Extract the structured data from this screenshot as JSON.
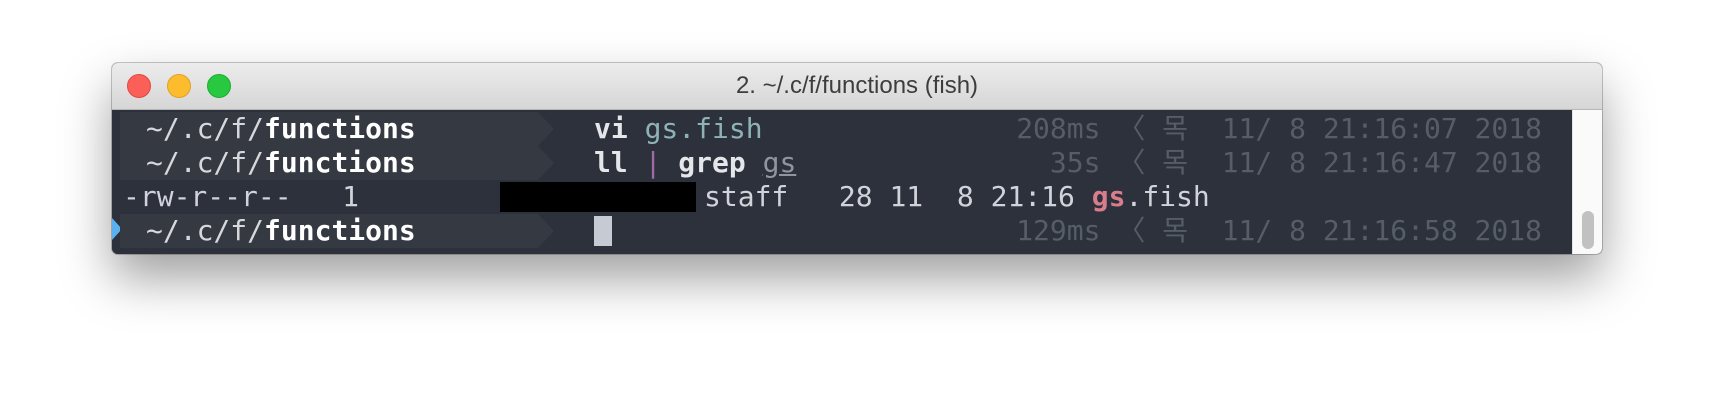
{
  "window": {
    "title": "2. ~/.c/f/functions (fish)"
  },
  "lines": [
    {
      "path_prefix": "~/.c/f/",
      "path_dir": "functions",
      "cmd": "vi",
      "arg": "gs.fish",
      "duration": "208ms",
      "timestamp": "목  11/ 8 21:16:07 2018"
    },
    {
      "path_prefix": "~/.c/f/",
      "path_dir": "functions",
      "cmd": "ll",
      "pipe": "|",
      "cmd2": "grep",
      "arg": "gs",
      "duration": "35s",
      "timestamp": "목  11/ 8 21:16:47 2018"
    },
    {
      "perms": "-rw-r--r--",
      "links": "1",
      "group": "staff",
      "size_date": "28 11  8 21:16",
      "match": "gs",
      "rest": ".fish"
    },
    {
      "path_prefix": "~/.c/f/",
      "path_dir": "functions",
      "duration": "129ms",
      "timestamp": "목  11/ 8 21:16:58 2018"
    }
  ],
  "glyphs": {
    "right_caret": "〈"
  },
  "colors": {
    "terminal_bg": "#2c313b",
    "prompt_bg": "#343942",
    "match": "#d97c8c",
    "indicator": "#5ab1ef"
  }
}
